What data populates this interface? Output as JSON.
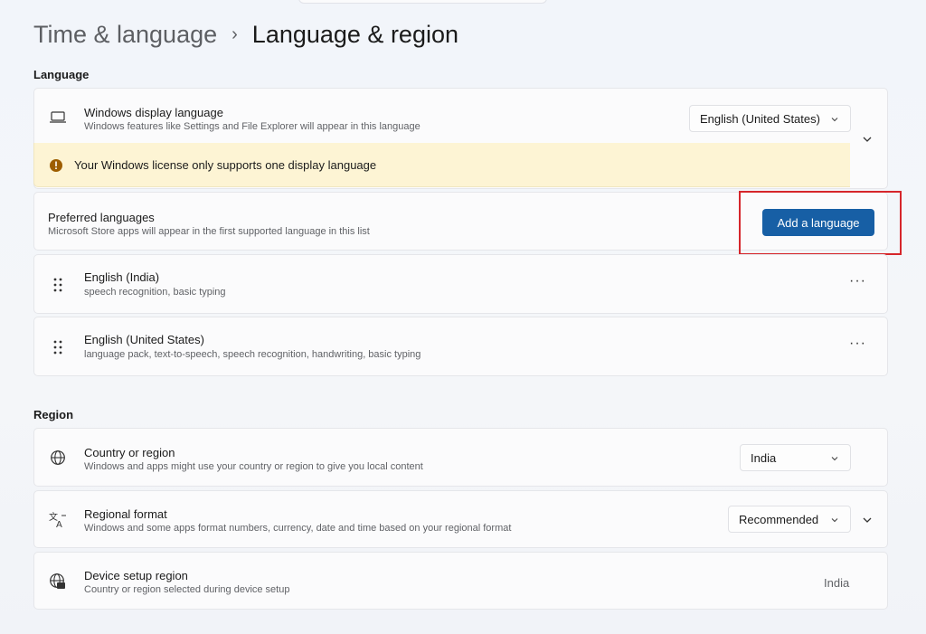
{
  "breadcrumb": {
    "parent": "Time & language",
    "separator": "›",
    "current": "Language & region"
  },
  "language_section": {
    "label": "Language",
    "display_language": {
      "title": "Windows display language",
      "subtitle": "Windows features like Settings and File Explorer will appear in this language",
      "value": "English (United States)",
      "icon": "laptop-icon"
    },
    "notice": "Your Windows license only supports one display language",
    "preferred": {
      "title": "Preferred languages",
      "subtitle": "Microsoft Store apps will appear in the first supported language in this list",
      "button": "Add a language"
    },
    "languages": [
      {
        "name": "English (India)",
        "features": "speech recognition, basic typing",
        "more": "···"
      },
      {
        "name": "English (United States)",
        "features": "language pack, text-to-speech, speech recognition, handwriting, basic typing",
        "more": "···"
      }
    ]
  },
  "region_section": {
    "label": "Region",
    "country": {
      "title": "Country or region",
      "subtitle": "Windows and apps might use your country or region to give you local content",
      "value": "India",
      "icon": "globe-icon"
    },
    "format": {
      "title": "Regional format",
      "subtitle": "Windows and some apps format numbers, currency, date and time based on your regional format",
      "value": "Recommended",
      "icon": "language-format-icon"
    },
    "device_region": {
      "title": "Device setup region",
      "subtitle": "Country or region selected during device setup",
      "value": "India",
      "icon": "globe-device-icon"
    }
  },
  "colors": {
    "accent": "#175fa5",
    "highlight": "#d6262b",
    "notice_bg": "#fdf4d4",
    "notice_icon": "#9d5d00"
  }
}
